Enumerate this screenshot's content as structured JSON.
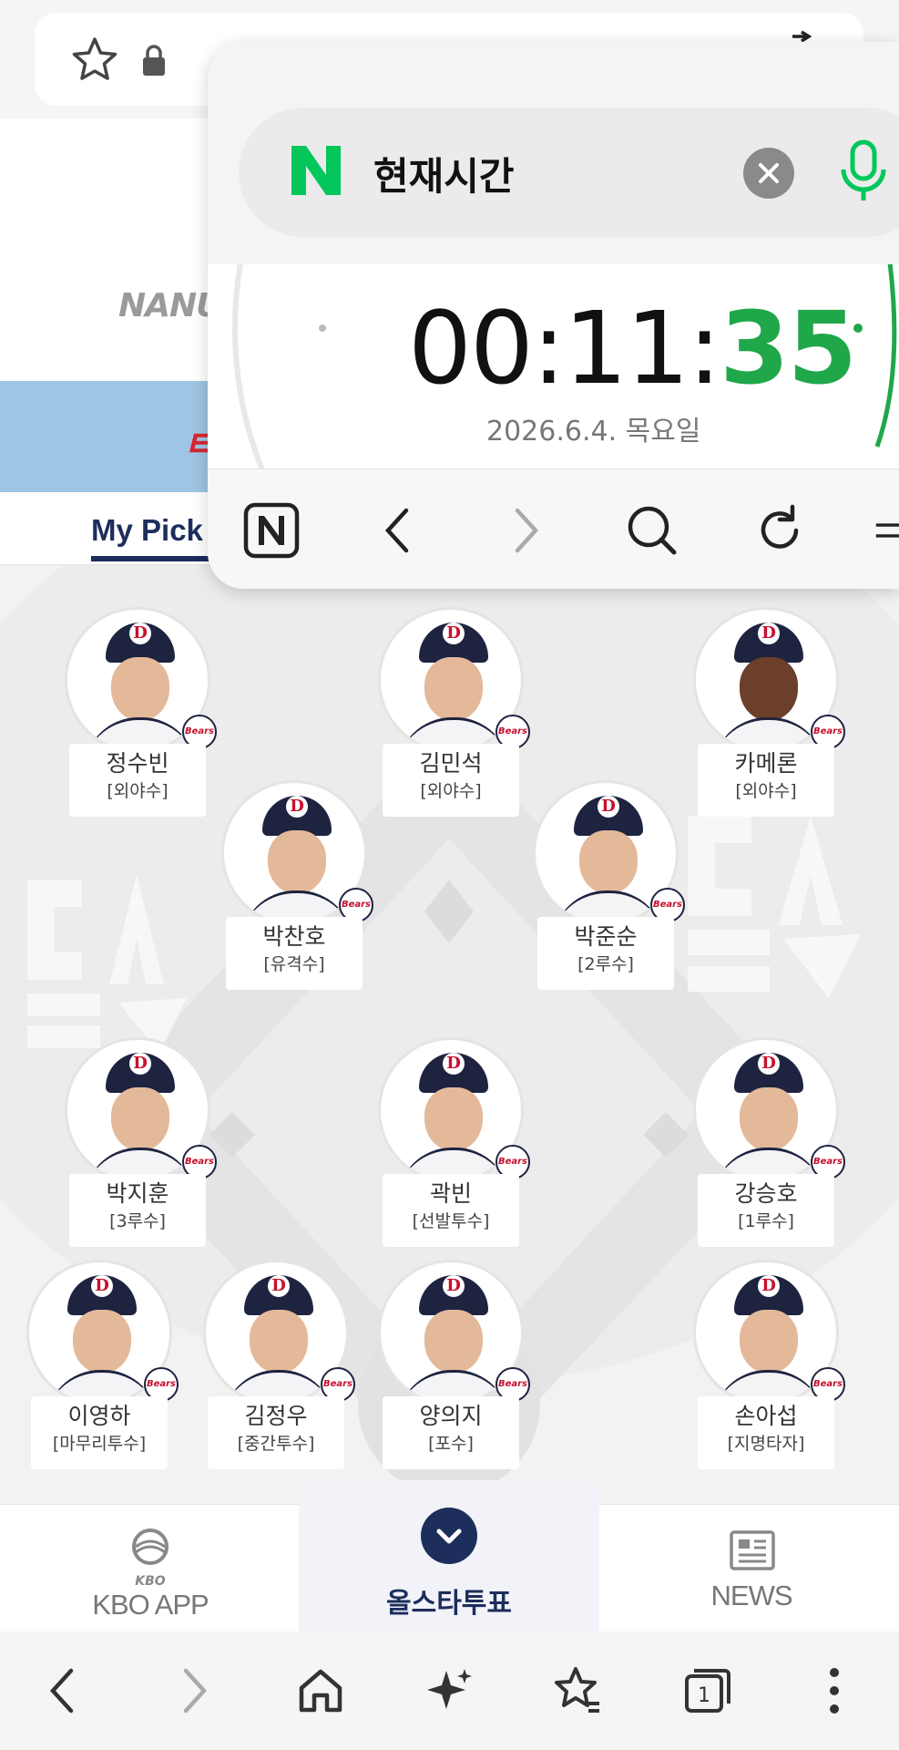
{
  "header": {
    "sponsor_logo": "NANUM",
    "tab_mypick": "My Pick"
  },
  "players": [
    {
      "name": "정수빈",
      "position": "[외야수]"
    },
    {
      "name": "김민석",
      "position": "[외야수]"
    },
    {
      "name": "카메론",
      "position": "[외야수]"
    },
    {
      "name": "박찬호",
      "position": "[유격수]"
    },
    {
      "name": "박준순",
      "position": "[2루수]"
    },
    {
      "name": "박지훈",
      "position": "[3루수]"
    },
    {
      "name": "곽빈",
      "position": "[선발투수]"
    },
    {
      "name": "강승호",
      "position": "[1루수]"
    },
    {
      "name": "이영하",
      "position": "[마무리투수]"
    },
    {
      "name": "김정우",
      "position": "[중간투수]"
    },
    {
      "name": "양의지",
      "position": "[포수]"
    },
    {
      "name": "손아섭",
      "position": "[지명타자]"
    }
  ],
  "team_badge": "Bears",
  "app_nav": {
    "kbo_logo_text": "KBO",
    "kbo_label": "KBO APP",
    "vote_label": "올스타투표",
    "news_label": "NEWS"
  },
  "popup": {
    "query": "현재시간",
    "clock_hm": "00:11:",
    "clock_sec": "35",
    "clock_date": "2026.6.4. 목요일"
  },
  "browser_bar": {
    "tab_count": "1"
  },
  "colors": {
    "navy": "#1d2d5c",
    "naver_green": "#03c75a",
    "banner_blue": "#9ec5e3"
  }
}
